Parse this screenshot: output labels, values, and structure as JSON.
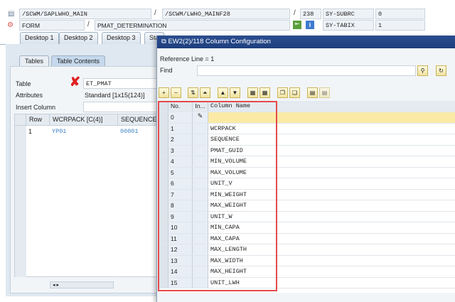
{
  "header": {
    "program": "/SCWM/SAPLWHO_MAIN",
    "include": "/SCWM/LWHO_MAINF28",
    "line": "238",
    "var1_name": "SY-SUBRC",
    "var1_value": "0",
    "event_type": "FORM",
    "event_name": "PMAT_DETERMINATION",
    "var2_name": "SY-TABIX",
    "var2_value": "1",
    "sep": "/"
  },
  "desktop_tabs": [
    "Desktop 1",
    "Desktop 2",
    "Desktop 3",
    "Sta"
  ],
  "left": {
    "tabs": [
      "Tables",
      "Table Contents"
    ],
    "table_label": "Table",
    "table_value": "ET_PMAT",
    "attributes_label": "Attributes",
    "attributes_value": "Standard [1x15(124)]",
    "insert_label": "Insert Column",
    "columns": [
      "Row",
      "WCRPACK [C(4)]",
      "SEQUENCE [N"
    ],
    "row": [
      "1",
      "YP01",
      "00001"
    ]
  },
  "dialog": {
    "title": "EW2(2)/118 Column Configuration",
    "reference": "Reference Line = 1",
    "find_label": "Find",
    "find_value": "",
    "columns": [
      "No.",
      "In...",
      "Column Name"
    ],
    "rows": [
      {
        "no": "0",
        "name": ""
      },
      {
        "no": "1",
        "name": "WCRPACK"
      },
      {
        "no": "2",
        "name": "SEQUENCE"
      },
      {
        "no": "3",
        "name": "PMAT_GUID"
      },
      {
        "no": "4",
        "name": "MIN_VOLUME"
      },
      {
        "no": "5",
        "name": "MAX_VOLUME"
      },
      {
        "no": "6",
        "name": "UNIT_V"
      },
      {
        "no": "7",
        "name": "MIN_WEIGHT"
      },
      {
        "no": "8",
        "name": "MAX_WEIGHT"
      },
      {
        "no": "9",
        "name": "UNIT_W"
      },
      {
        "no": "10",
        "name": "MIN_CAPA"
      },
      {
        "no": "11",
        "name": "MAX_CAPA"
      },
      {
        "no": "12",
        "name": "MAX_LENGTH"
      },
      {
        "no": "13",
        "name": "MAX_WIDTH"
      },
      {
        "no": "14",
        "name": "MAX_HEIGHT"
      },
      {
        "no": "15",
        "name": "UNIT_LWH"
      }
    ]
  },
  "colors": {
    "title_bar": "#1e3f7e",
    "highlight": "#fbeaa6",
    "link": "#3b7fc4",
    "red": "#e34a4a"
  }
}
